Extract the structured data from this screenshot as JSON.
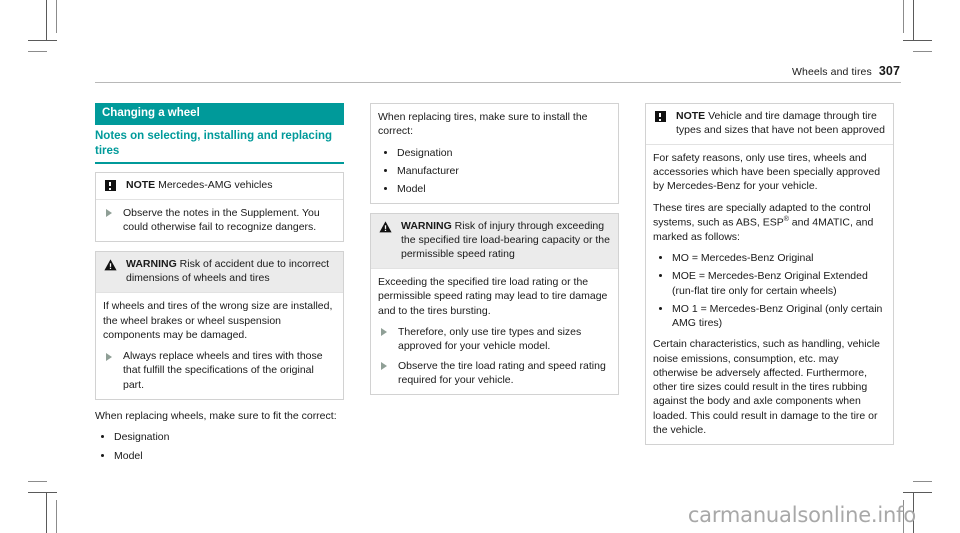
{
  "running_head": {
    "section": "Wheels and tires",
    "page_number": "307"
  },
  "colors": {
    "accent_teal": "#009a9a",
    "warning_band": "#ebebeb",
    "box_border": "#d2d2d2",
    "triangle_bullet": "#8f9f96"
  },
  "column1": {
    "banner": "Changing a wheel",
    "subtitle": "Notes on selecting, installing and replacing tires",
    "note_box": {
      "icon": "note-exclamation-icon",
      "label": "NOTE",
      "title": "Mercedes-AMG vehicles",
      "items": [
        "Observe the notes in the Supplement. You could otherwise fail to recognize dangers."
      ]
    },
    "warning_box": {
      "icon": "warning-triangle-icon",
      "label": "WARNING",
      "title": "Risk of accident due to incorrect dimensions of wheels and tires",
      "body": "If wheels and tires of the wrong size are installed, the wheel brakes or wheel suspension components may be damaged.",
      "items": [
        "Always replace wheels and tires with those that fulfill the specifications of the original part."
      ]
    },
    "closing_para": "When replacing wheels, make sure to fit the correct:",
    "closing_list": [
      "Designation",
      "Model"
    ]
  },
  "column2": {
    "intro_box": {
      "para": "When replacing tires, make sure to install the correct:",
      "list": [
        "Designation",
        "Manufacturer",
        "Model"
      ]
    },
    "warning_box": {
      "icon": "warning-triangle-icon",
      "label": "WARNING",
      "title": "Risk of injury through exceeding the specified tire load-bearing capacity or the permissible speed rating",
      "body": "Exceeding the specified tire load rating or the permissible speed rating may lead to tire damage and to the tires bursting.",
      "items": [
        "Therefore, only use tire types and sizes approved for your vehicle model.",
        "Observe the tire load rating and speed rating required for your vehicle."
      ]
    }
  },
  "column3": {
    "note_box": {
      "icon": "note-exclamation-icon",
      "label": "NOTE",
      "title": "Vehicle and tire damage through tire types and sizes that have not been approved",
      "para1": "For safety reasons, only use tires, wheels and accessories which have been specially approved by Mercedes-Benz for your vehicle.",
      "para2_part1": "These tires are specially adapted to the control systems, such as ABS, ESP",
      "para2_sup": "®",
      "para2_part2": " and 4MATIC, and marked as follows:",
      "markings": [
        "MO = Mercedes-Benz Original",
        "MOE = Mercedes-Benz Original Extended (run-flat tire only for certain wheels)",
        "MO 1 = Mercedes-Benz Original (only certain AMG tires)"
      ],
      "closing_para": "Certain characteristics, such as handling, vehicle noise emissions, consumption, etc. may otherwise be adversely affected. Furthermore, other tire sizes could result in the tires rubbing against the body and axle components when loaded. This could result in damage to the tire or the vehicle."
    }
  },
  "watermark": "carmanualsonline.info"
}
